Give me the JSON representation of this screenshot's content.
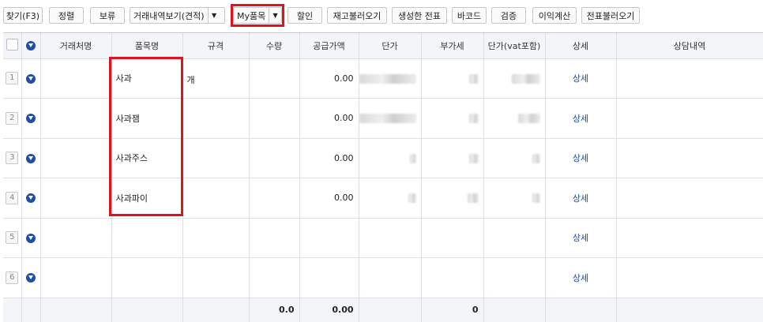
{
  "toolbar": {
    "find": "찾기(F3)",
    "sort": "정렬",
    "hold": "보류",
    "history_view": "거래내역보기(견적)",
    "my_items": "My품목",
    "discount": "할인",
    "stock_load": "재고불러오기",
    "created_voucher": "생성한 전표",
    "barcode": "바코드",
    "verify": "검증",
    "profit_calc": "이익계산",
    "voucher_load": "전표불러오기"
  },
  "grid": {
    "headers": {
      "partner": "거래처명",
      "item": "품목명",
      "spec": "규격",
      "qty": "수량",
      "supply": "공급가액",
      "unit_price": "단가",
      "vat": "부가세",
      "unit_price_vat": "단가(vat포함)",
      "detail": "상세",
      "consult": "상담내역"
    },
    "rows": [
      {
        "no": "1",
        "item": "사과",
        "spec": "개",
        "supply": "0.00",
        "detail": "상세"
      },
      {
        "no": "2",
        "item": "사과잼",
        "spec": "",
        "supply": "0.00",
        "detail": "상세"
      },
      {
        "no": "3",
        "item": "사과주스",
        "spec": "",
        "supply": "0.00",
        "detail": "상세"
      },
      {
        "no": "4",
        "item": "사과파이",
        "spec": "",
        "supply": "0.00",
        "detail": "상세"
      },
      {
        "no": "5",
        "item": "",
        "spec": "",
        "supply": "",
        "detail": "상세"
      },
      {
        "no": "6",
        "item": "",
        "spec": "",
        "supply": "",
        "detail": "상세"
      }
    ],
    "totals": {
      "qty": "0.0",
      "supply": "0.00",
      "vat": "0"
    }
  },
  "colors": {
    "highlight": "#e0121b",
    "link": "#1b4f9c",
    "header_bg": "#f3f5f8"
  }
}
